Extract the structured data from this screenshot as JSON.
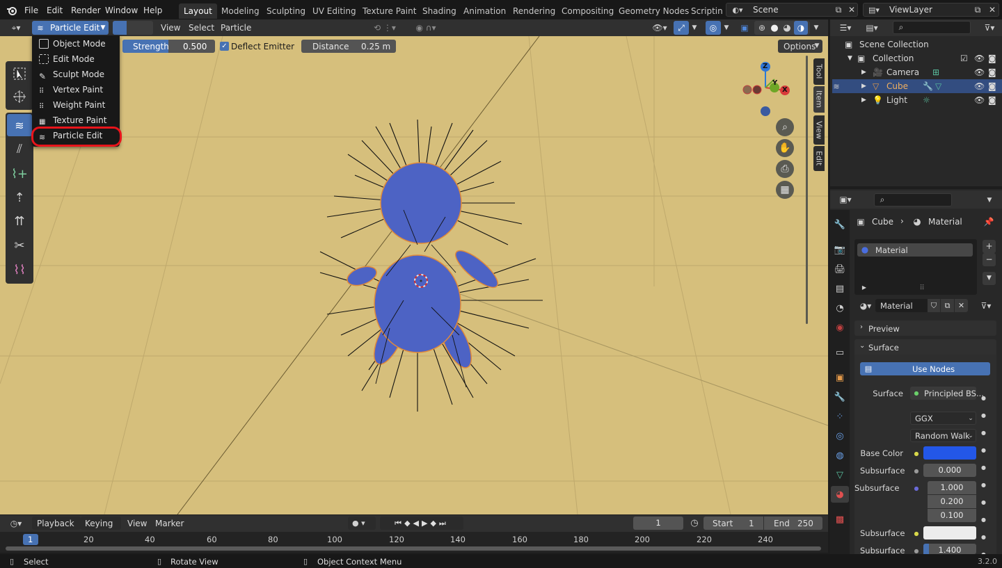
{
  "topbar": {
    "menus": [
      "File",
      "Edit",
      "Render",
      "Window",
      "Help"
    ],
    "workspaces": [
      "Layout",
      "Modeling",
      "Sculpting",
      "UV Editing",
      "Texture Paint",
      "Shading",
      "Animation",
      "Rendering",
      "Compositing",
      "Geometry Nodes",
      "Scripting"
    ],
    "active_workspace": "Layout",
    "scene": "Scene",
    "view_layer": "ViewLayer"
  },
  "viewport_header": {
    "mode": "Particle Edit",
    "menus": [
      "View",
      "Select",
      "Particle"
    ]
  },
  "tool_settings": {
    "strength_label": "Strength",
    "strength_value": "0.500",
    "deflect_label": "Deflect Emitter",
    "distance_label": "Distance",
    "distance_value": "0.25 m",
    "options_label": "Options"
  },
  "mode_menu": {
    "items": [
      "Object Mode",
      "Edit Mode",
      "Sculpt Mode",
      "Vertex Paint",
      "Weight Paint",
      "Texture Paint",
      "Particle Edit"
    ],
    "highlighted": "Particle Edit"
  },
  "side_tabs": [
    "Tool",
    "Item",
    "View",
    "Edit"
  ],
  "gizmo": {
    "z": "Z",
    "y": "Y",
    "x": "X"
  },
  "outliner": {
    "root": "Scene Collection",
    "collection": "Collection",
    "objects": [
      {
        "name": "Camera",
        "selected": false
      },
      {
        "name": "Cube",
        "selected": true
      },
      {
        "name": "Light",
        "selected": false
      }
    ]
  },
  "properties": {
    "breadcrumb_object": "Cube",
    "breadcrumb_data": "Material",
    "slot": "Material",
    "material_name": "Material",
    "panel_preview": "Preview",
    "panel_surface": "Surface",
    "use_nodes": "Use Nodes",
    "surface_label": "Surface",
    "surface_value": "Principled BS...",
    "distribution": "GGX",
    "subsurface_method": "Random Walk",
    "base_color_label": "Base Color",
    "base_color": "#2357e8",
    "subsurface_label": "Subsurface",
    "subsurface_value": "0.000",
    "subsurface_radius_label": "Subsurface",
    "radius_values": [
      "1.000",
      "0.200",
      "0.100"
    ],
    "subsurface_color_label": "Subsurface",
    "subsurface_ior_label": "Subsurface",
    "subsurface_ior_value": "1.400"
  },
  "timeline": {
    "menus": [
      "Playback",
      "Keying",
      "View",
      "Marker"
    ],
    "current_frame": "1",
    "start_label": "Start",
    "start_value": "1",
    "end_label": "End",
    "end_value": "250",
    "ticks": [
      "1",
      "20",
      "40",
      "60",
      "80",
      "100",
      "120",
      "140",
      "160",
      "180",
      "200",
      "220",
      "240"
    ]
  },
  "statusbar": {
    "select": "Select",
    "rotate": "Rotate View",
    "context": "Object Context Menu",
    "version": "3.2.0"
  },
  "colors": {
    "viewport_bg": "#d6bf7c",
    "accent": "#4772b3",
    "highlight_ring": "#e8141b"
  }
}
